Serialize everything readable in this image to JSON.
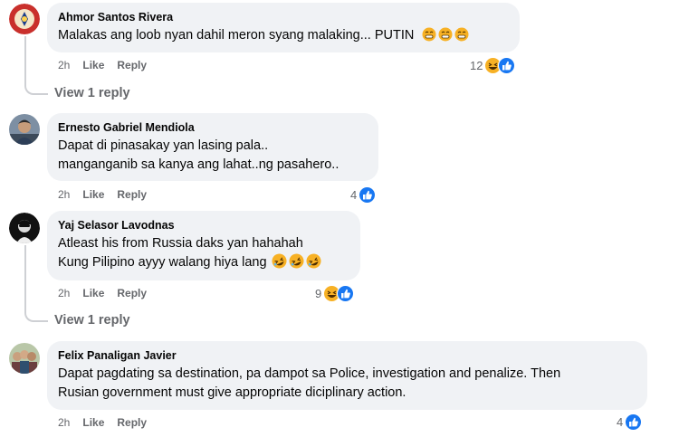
{
  "comments": [
    {
      "author": "Ahmor Santos Rivera",
      "lines": [
        "Malakas ang loob nyan dahil meron syang malaking... PUTIN"
      ],
      "time": "2h",
      "like": "Like",
      "reply": "Reply",
      "reaction_count": "12",
      "reactions": [
        "haha",
        "like"
      ],
      "trailing_emoji": "grimace-emoji x3",
      "view_reply": "View 1 reply"
    },
    {
      "author": "Ernesto Gabriel Mendiola",
      "lines": [
        "Dapat di pinasakay yan lasing pala..",
        "manganganib sa kanya ang lahat..ng pasahero.."
      ],
      "time": "2h",
      "like": "Like",
      "reply": "Reply",
      "reaction_count": "4",
      "reactions": [
        "like"
      ]
    },
    {
      "author": "Yaj Selasor Lavodnas",
      "lines": [
        "Atleast his from Russia daks yan hahahah",
        "Kung Pilipino ayyy walang hiya lang"
      ],
      "time": "2h",
      "like": "Like",
      "reply": "Reply",
      "reaction_count": "9",
      "reactions": [
        "haha",
        "like"
      ],
      "trailing_emoji": "rofl-emoji x3",
      "view_reply": "View 1 reply"
    },
    {
      "author": "Felix Panaligan Javier",
      "lines": [
        "Dapat pagdating sa destination, pa dampot sa Police, investigation and penalize. Then",
        "Rusian government must give appropriate diciplinary action."
      ],
      "time": "2h",
      "like": "Like",
      "reply": "Reply",
      "reaction_count": "4",
      "reactions": [
        "like"
      ]
    }
  ],
  "colors": {
    "bubble_bg": "#f0f2f5",
    "meta_text": "#65676b",
    "like_blue": "#1877f2",
    "haha_yellow": "#f7b125"
  }
}
